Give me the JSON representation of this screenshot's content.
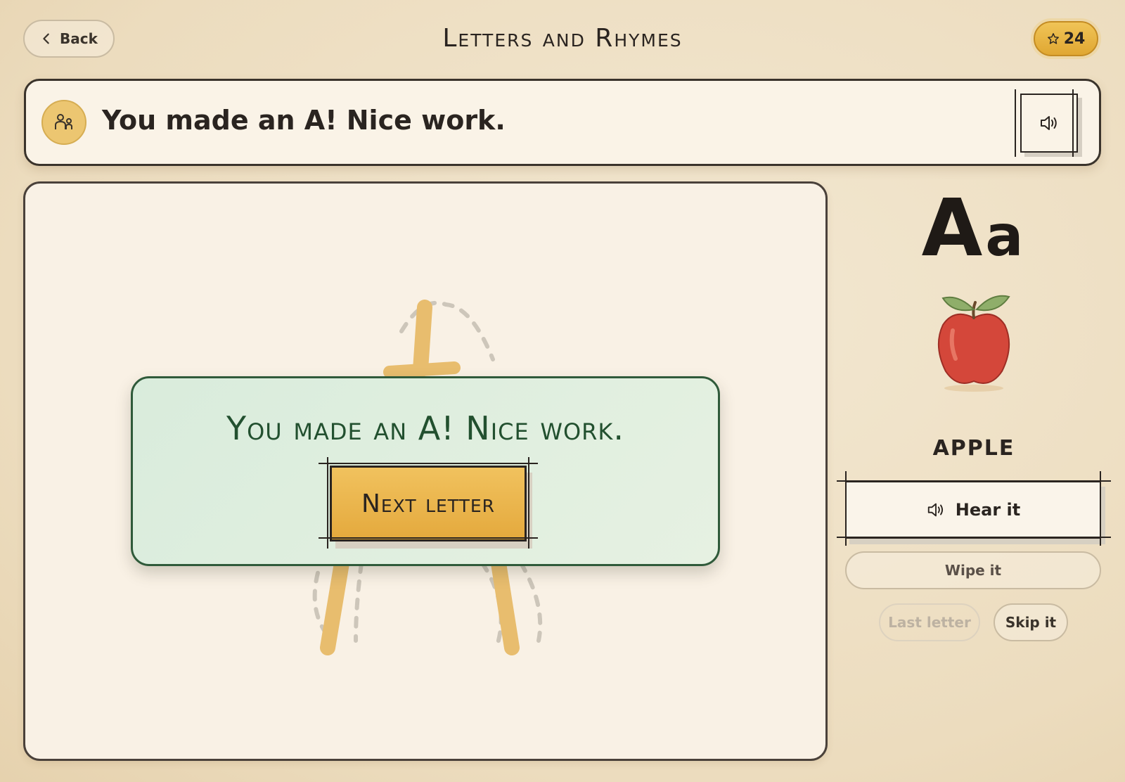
{
  "header": {
    "back_label": "Back",
    "title": "Letters and Rhymes",
    "stars": "24"
  },
  "prompt": {
    "text": "You made an A! Nice work."
  },
  "success": {
    "message": "You made an A! Nice work.",
    "next_label": "Next letter"
  },
  "letter": {
    "upper": "A",
    "lower": "a",
    "word": "APPLE",
    "picture": "apple-illustration"
  },
  "controls": {
    "hear_label": "Hear it",
    "wipe_label": "Wipe it",
    "last_label": "Last letter",
    "skip_label": "Skip it",
    "last_enabled": false
  },
  "colors": {
    "accent": "#e4a93d",
    "success_bg": "#d9ecdc",
    "success_text": "#22502f",
    "trace_stroke": "#e8bd6e"
  }
}
